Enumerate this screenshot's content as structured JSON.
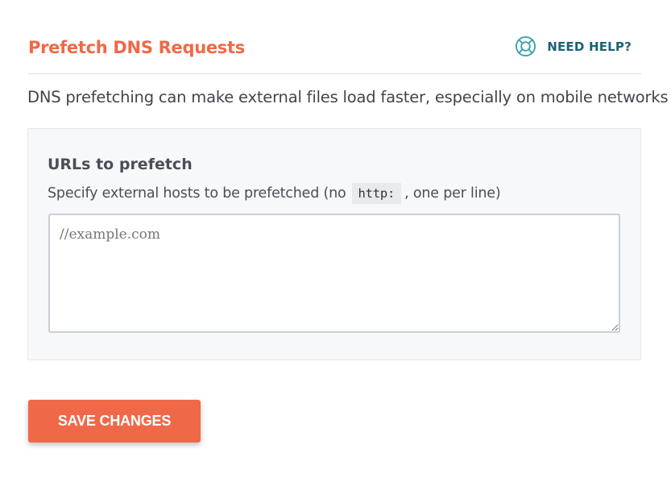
{
  "section": {
    "title": "Prefetch DNS Requests",
    "help_label": "NEED HELP?",
    "help_icon": "lifebuoy-icon",
    "description": "DNS prefetching can make external files load faster, especially on mobile networks"
  },
  "panel": {
    "title": "URLs to prefetch",
    "desc_before": "Specify external hosts to be prefetched (no",
    "desc_code": "http:",
    "desc_after": ", one per line)",
    "textarea": {
      "value": "",
      "placeholder": "//example.com"
    }
  },
  "actions": {
    "save_label": "SAVE CHANGES"
  },
  "colors": {
    "accent": "#ee6947",
    "help": "#1c6274",
    "help_icon": "#3fa2b1",
    "text": "#40454d",
    "panel_bg": "#f7f8fa"
  }
}
